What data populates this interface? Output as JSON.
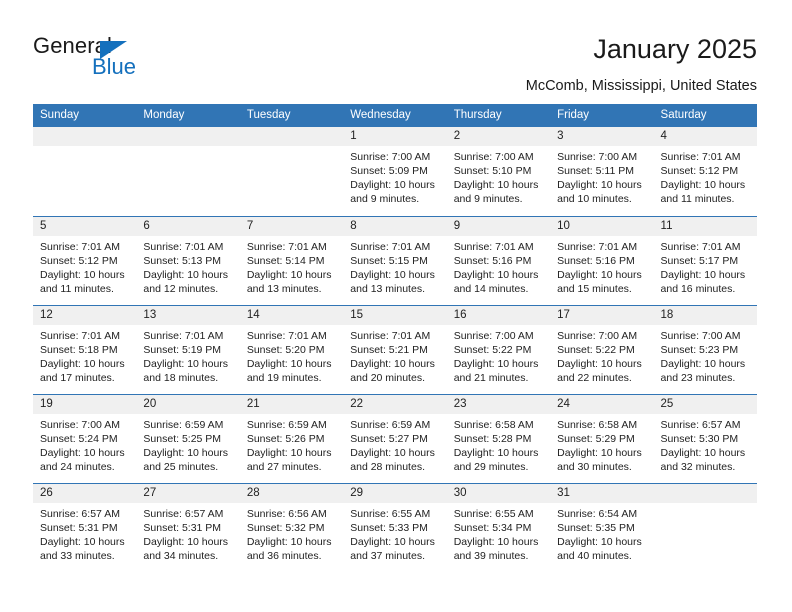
{
  "logo": {
    "word_top": "General",
    "word_bottom": "Blue",
    "triangle_color": "#1470bd",
    "text_color": "#1a1a1a"
  },
  "header": {
    "title": "January 2025",
    "subtitle": "McComb, Mississippi, United States"
  },
  "theme": {
    "header_blue": "#3175b5",
    "daynum_gray": "#f0f0f0",
    "text": "#222222"
  },
  "calendar": {
    "weekday_headers": [
      "Sunday",
      "Monday",
      "Tuesday",
      "Wednesday",
      "Thursday",
      "Friday",
      "Saturday"
    ],
    "labels": {
      "sunrise_prefix": "Sunrise: ",
      "sunset_prefix": "Sunset: ",
      "daylight_prefix": "Daylight: "
    },
    "weeks": [
      [
        {
          "day": "",
          "empty": true
        },
        {
          "day": "",
          "empty": true
        },
        {
          "day": "",
          "empty": true
        },
        {
          "day": "1",
          "sunrise": "Sunrise: 7:00 AM",
          "sunset": "Sunset: 5:09 PM",
          "daylight": "Daylight: 10 hours and 9 minutes."
        },
        {
          "day": "2",
          "sunrise": "Sunrise: 7:00 AM",
          "sunset": "Sunset: 5:10 PM",
          "daylight": "Daylight: 10 hours and 9 minutes."
        },
        {
          "day": "3",
          "sunrise": "Sunrise: 7:00 AM",
          "sunset": "Sunset: 5:11 PM",
          "daylight": "Daylight: 10 hours and 10 minutes."
        },
        {
          "day": "4",
          "sunrise": "Sunrise: 7:01 AM",
          "sunset": "Sunset: 5:12 PM",
          "daylight": "Daylight: 10 hours and 11 minutes."
        }
      ],
      [
        {
          "day": "5",
          "sunrise": "Sunrise: 7:01 AM",
          "sunset": "Sunset: 5:12 PM",
          "daylight": "Daylight: 10 hours and 11 minutes."
        },
        {
          "day": "6",
          "sunrise": "Sunrise: 7:01 AM",
          "sunset": "Sunset: 5:13 PM",
          "daylight": "Daylight: 10 hours and 12 minutes."
        },
        {
          "day": "7",
          "sunrise": "Sunrise: 7:01 AM",
          "sunset": "Sunset: 5:14 PM",
          "daylight": "Daylight: 10 hours and 13 minutes."
        },
        {
          "day": "8",
          "sunrise": "Sunrise: 7:01 AM",
          "sunset": "Sunset: 5:15 PM",
          "daylight": "Daylight: 10 hours and 13 minutes."
        },
        {
          "day": "9",
          "sunrise": "Sunrise: 7:01 AM",
          "sunset": "Sunset: 5:16 PM",
          "daylight": "Daylight: 10 hours and 14 minutes."
        },
        {
          "day": "10",
          "sunrise": "Sunrise: 7:01 AM",
          "sunset": "Sunset: 5:16 PM",
          "daylight": "Daylight: 10 hours and 15 minutes."
        },
        {
          "day": "11",
          "sunrise": "Sunrise: 7:01 AM",
          "sunset": "Sunset: 5:17 PM",
          "daylight": "Daylight: 10 hours and 16 minutes."
        }
      ],
      [
        {
          "day": "12",
          "sunrise": "Sunrise: 7:01 AM",
          "sunset": "Sunset: 5:18 PM",
          "daylight": "Daylight: 10 hours and 17 minutes."
        },
        {
          "day": "13",
          "sunrise": "Sunrise: 7:01 AM",
          "sunset": "Sunset: 5:19 PM",
          "daylight": "Daylight: 10 hours and 18 minutes."
        },
        {
          "day": "14",
          "sunrise": "Sunrise: 7:01 AM",
          "sunset": "Sunset: 5:20 PM",
          "daylight": "Daylight: 10 hours and 19 minutes."
        },
        {
          "day": "15",
          "sunrise": "Sunrise: 7:01 AM",
          "sunset": "Sunset: 5:21 PM",
          "daylight": "Daylight: 10 hours and 20 minutes."
        },
        {
          "day": "16",
          "sunrise": "Sunrise: 7:00 AM",
          "sunset": "Sunset: 5:22 PM",
          "daylight": "Daylight: 10 hours and 21 minutes."
        },
        {
          "day": "17",
          "sunrise": "Sunrise: 7:00 AM",
          "sunset": "Sunset: 5:22 PM",
          "daylight": "Daylight: 10 hours and 22 minutes."
        },
        {
          "day": "18",
          "sunrise": "Sunrise: 7:00 AM",
          "sunset": "Sunset: 5:23 PM",
          "daylight": "Daylight: 10 hours and 23 minutes."
        }
      ],
      [
        {
          "day": "19",
          "sunrise": "Sunrise: 7:00 AM",
          "sunset": "Sunset: 5:24 PM",
          "daylight": "Daylight: 10 hours and 24 minutes."
        },
        {
          "day": "20",
          "sunrise": "Sunrise: 6:59 AM",
          "sunset": "Sunset: 5:25 PM",
          "daylight": "Daylight: 10 hours and 25 minutes."
        },
        {
          "day": "21",
          "sunrise": "Sunrise: 6:59 AM",
          "sunset": "Sunset: 5:26 PM",
          "daylight": "Daylight: 10 hours and 27 minutes."
        },
        {
          "day": "22",
          "sunrise": "Sunrise: 6:59 AM",
          "sunset": "Sunset: 5:27 PM",
          "daylight": "Daylight: 10 hours and 28 minutes."
        },
        {
          "day": "23",
          "sunrise": "Sunrise: 6:58 AM",
          "sunset": "Sunset: 5:28 PM",
          "daylight": "Daylight: 10 hours and 29 minutes."
        },
        {
          "day": "24",
          "sunrise": "Sunrise: 6:58 AM",
          "sunset": "Sunset: 5:29 PM",
          "daylight": "Daylight: 10 hours and 30 minutes."
        },
        {
          "day": "25",
          "sunrise": "Sunrise: 6:57 AM",
          "sunset": "Sunset: 5:30 PM",
          "daylight": "Daylight: 10 hours and 32 minutes."
        }
      ],
      [
        {
          "day": "26",
          "sunrise": "Sunrise: 6:57 AM",
          "sunset": "Sunset: 5:31 PM",
          "daylight": "Daylight: 10 hours and 33 minutes."
        },
        {
          "day": "27",
          "sunrise": "Sunrise: 6:57 AM",
          "sunset": "Sunset: 5:31 PM",
          "daylight": "Daylight: 10 hours and 34 minutes."
        },
        {
          "day": "28",
          "sunrise": "Sunrise: 6:56 AM",
          "sunset": "Sunset: 5:32 PM",
          "daylight": "Daylight: 10 hours and 36 minutes."
        },
        {
          "day": "29",
          "sunrise": "Sunrise: 6:55 AM",
          "sunset": "Sunset: 5:33 PM",
          "daylight": "Daylight: 10 hours and 37 minutes."
        },
        {
          "day": "30",
          "sunrise": "Sunrise: 6:55 AM",
          "sunset": "Sunset: 5:34 PM",
          "daylight": "Daylight: 10 hours and 39 minutes."
        },
        {
          "day": "31",
          "sunrise": "Sunrise: 6:54 AM",
          "sunset": "Sunset: 5:35 PM",
          "daylight": "Daylight: 10 hours and 40 minutes."
        },
        {
          "day": "",
          "empty": true
        }
      ]
    ]
  }
}
